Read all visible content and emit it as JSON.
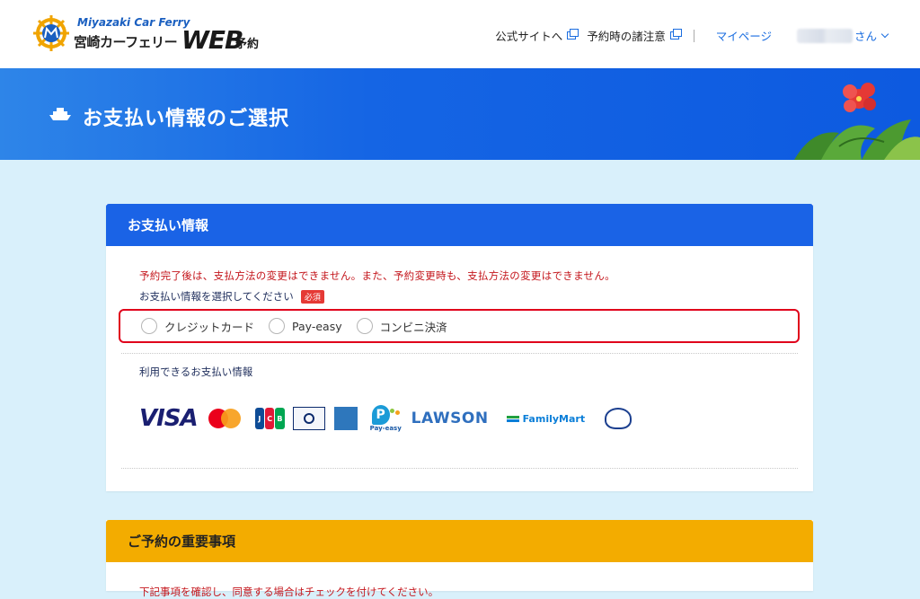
{
  "header": {
    "logo_en": "Miyazaki Car Ferry",
    "logo_ja": "宮崎カーフェリー",
    "logo_web": "WEB",
    "logo_yoyaku": "予約",
    "nav": {
      "official_site": "公式サイトへ",
      "notes": "予約時の諸注意",
      "mypage": "マイページ",
      "user_suffix": "さん"
    }
  },
  "banner": {
    "title": "お支払い情報のご選択"
  },
  "payment_card": {
    "title": "お支払い情報",
    "notice": "予約完了後は、支払方法の変更はできません。また、予約変更時も、支払方法の変更はできません。",
    "select_label": "お支払い情報を選択してください",
    "required_badge": "必須",
    "options": [
      {
        "label": "クレジットカード",
        "selected": false
      },
      {
        "label": "Pay-easy",
        "selected": false
      },
      {
        "label": "コンビニ決済",
        "selected": false
      }
    ],
    "available_label": "利用できるお支払い情報",
    "brand_logos": {
      "visa": "VISA",
      "jcb": [
        "J",
        "C",
        "B"
      ],
      "diners": "Diners Club INTERNATIONAL",
      "amex": "AMERICAN EXPRESS",
      "payeasy": "Pay-easy",
      "lawson": "LAWSON",
      "familymart": "FamilyMart",
      "ministop": "MINI STOP"
    }
  },
  "important_card": {
    "title": "ご予約の重要事項",
    "text": "下記事項を確認し、同意する場合はチェックを付けてください。"
  },
  "colors": {
    "header_blue": "#1a63e6",
    "accent_red": "#e0001b",
    "notice_red": "#c4161c",
    "important_yellow": "#f3ac00",
    "page_bg": "#d9f0fb"
  }
}
